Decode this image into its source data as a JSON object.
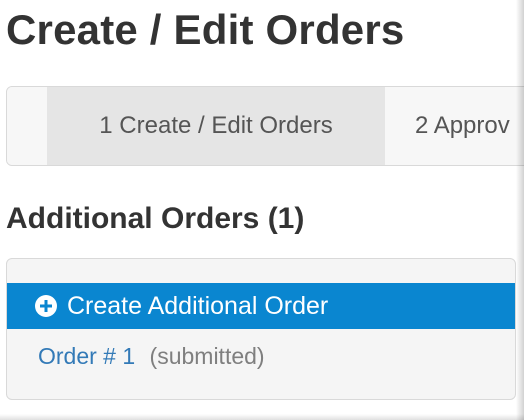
{
  "page": {
    "title": "Create / Edit Orders"
  },
  "steps": [
    {
      "label": "1 Create / Edit Orders"
    },
    {
      "label": "2 Approv"
    }
  ],
  "section": {
    "heading": "Additional Orders (1)"
  },
  "panel": {
    "create_label": "Create Additional Order",
    "orders": [
      {
        "link": "Order # 1",
        "status": "(submitted)"
      }
    ]
  },
  "colors": {
    "title": "#333333",
    "active_row_bg": "#0a86d0",
    "link": "#337ab7",
    "status": "#7f7f7f"
  },
  "icons": {
    "create": "plus-circle-icon"
  }
}
